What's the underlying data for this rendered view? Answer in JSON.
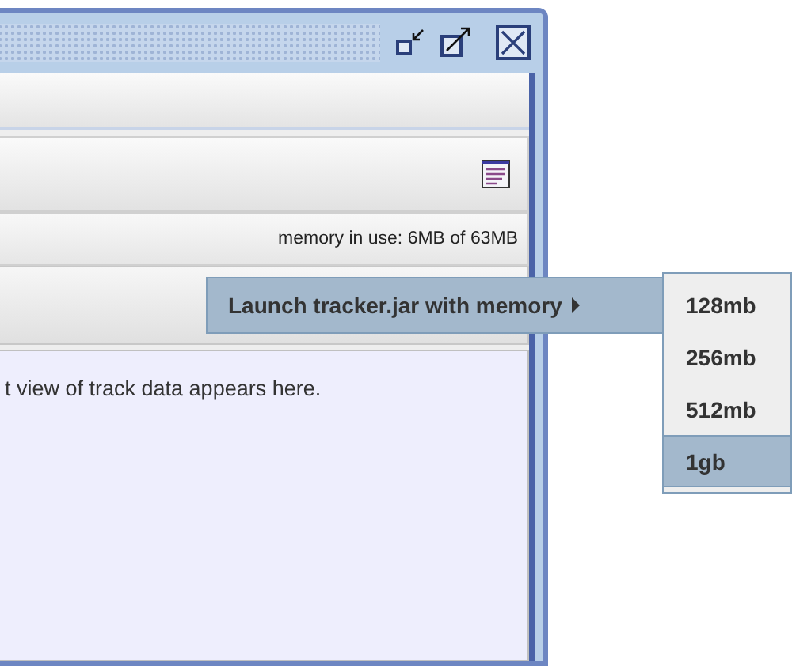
{
  "status_bar": {
    "memory": "memory in use: 6MB of 63MB"
  },
  "content": {
    "message": "t view of track data appears here."
  },
  "context_menu": {
    "items": [
      {
        "label": "Launch tracker.jar with memory",
        "selected": true,
        "has_submenu": true
      }
    ]
  },
  "submenu": {
    "items": [
      {
        "label": "128mb",
        "selected": false
      },
      {
        "label": "256mb",
        "selected": false
      },
      {
        "label": "512mb",
        "selected": false
      },
      {
        "label": "1gb",
        "selected": true
      }
    ]
  }
}
